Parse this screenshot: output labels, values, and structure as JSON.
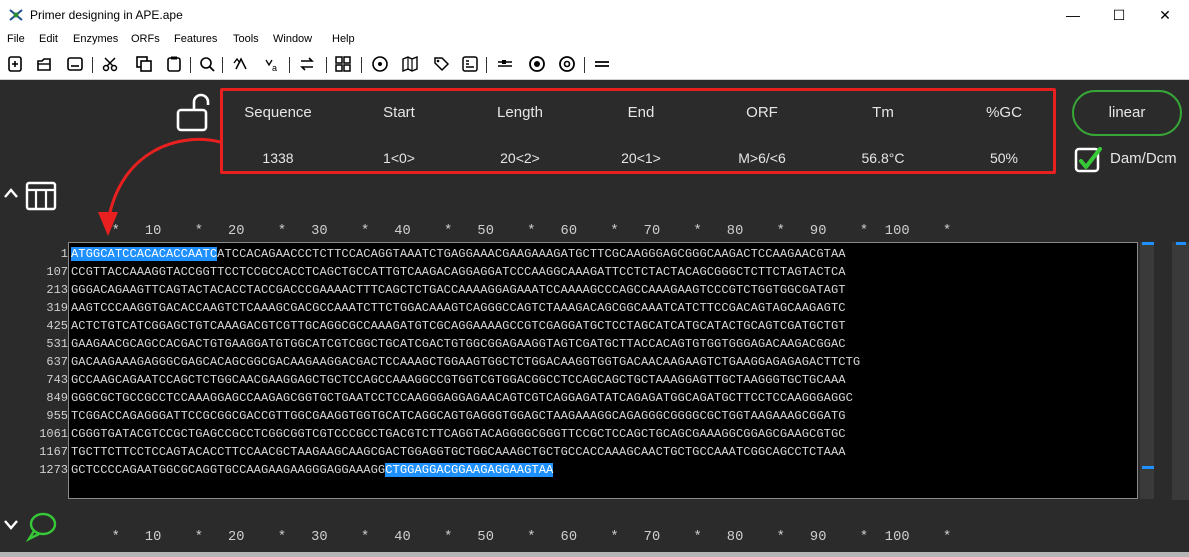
{
  "window": {
    "title": "Primer designing in APE.ape",
    "minimize": "—",
    "maximize": "☐",
    "close": "✕"
  },
  "menu": [
    "File",
    "Edit",
    "Enzymes",
    "ORFs",
    "Features",
    "Tools",
    "Window",
    "Help"
  ],
  "toolbar_icons": [
    "new-file-icon",
    "open-file-icon",
    "save-icon",
    "cut-icon",
    "copy-icon",
    "paste-icon",
    "find-icon",
    "translate-forward-icon",
    "translate-reverse-icon",
    "reverse-complement-icon",
    "enzyme-table-icon",
    "circular-map-icon",
    "linear-map-icon",
    "tag-icon",
    "features-icon",
    "align-icon",
    "gel-icon",
    "cd-icon",
    "list-icon"
  ],
  "info": {
    "headers": [
      "Sequence",
      "Start",
      "Length",
      "End",
      "ORF",
      "Tm",
      "%GC"
    ],
    "values": [
      "1338",
      "1<0>",
      "20<2>",
      "20<1>",
      "M>6/<6",
      "56.8°C",
      "50%"
    ]
  },
  "topology_button": "linear",
  "dam_dcm_label": "Dam/Dcm",
  "dam_dcm_checked": true,
  "ruler": "     *   10    *   20    *   30    *   40    *   50    *   60    *   70    *   80    *   90    *  100    *",
  "sequence": {
    "line_numbers": [
      "1",
      "107",
      "213",
      "319",
      "425",
      "531",
      "637",
      "743",
      "849",
      "955",
      "1061",
      "1167",
      "1273"
    ],
    "lines": [
      {
        "hl_start": "ATGGCATCCACACACCAATC",
        "text": "ATCCACAGAACCCTCTTCCACAGGTAAATCTGAGGAAACGAAGAAAGATGCTTCGCAAGGGAGCGGGCAAGACTCCAAGAACGTAA",
        "hl_end": ""
      },
      {
        "hl_start": "",
        "text": "CCGTTACCAAAGGTACCGGTTCCTCCGCCACCTCAGCTGCCATTGTCAAGACAGGAGGATCCCAAGGCAAAGATTCCTCTACTACAGCGGGCTCTTCTAGTACTCA",
        "hl_end": ""
      },
      {
        "hl_start": "",
        "text": "GGGACAGAAGTTCAGTACTACACCTACCGACCCGAAAACTTTCAGCTCTGACCAAAAGGAGAAATCCAAAAGCCCAGCCAAAGAAGTCCCGTCTGGTGGCGATAGT",
        "hl_end": ""
      },
      {
        "hl_start": "",
        "text": "AAGTCCCAAGGTGACACCAAGTCTCAAAGCGACGCCAAATCTTCTGGACAAAGTCAGGGCCAGTCTAAAGACAGCGGCAAATCATCTTCCGACAGTAGCAAGAGTC",
        "hl_end": ""
      },
      {
        "hl_start": "",
        "text": "ACTCTGTCATCGGAGCTGTCAAAGACGTCGTTGCAGGCGCCAAAGATGTCGCAGGAAAAGCCGTCGAGGATGCTCCTAGCATCATGCATACTGCAGTCGATGCTGT",
        "hl_end": ""
      },
      {
        "hl_start": "",
        "text": "GAAGAACGCAGCCACGACTGTGAAGGATGTGGCATCGTCGGCTGCATCGACTGTGGCGGAGAAGGTAGTCGATGCTTACCACAGTGTGGTGGGAGACAAGACGGAC",
        "hl_end": ""
      },
      {
        "hl_start": "",
        "text": "GACAAGAAAGAGGGCGAGCACAGCGGCGACAAGAAGGACGACTCCAAAGCTGGAAGTGGCTCTGGACAAGGTGGTGACAACAAGAAGTCTGAAGGAGAGAGACTTCTG",
        "hl_end": ""
      },
      {
        "hl_start": "",
        "text": "GCCAAGCAGAATCCAGCTCTGGCAACGAAGGAGCTGCTCCAGCCAAAGGCCGTGGTCGTGGACGGCCTCCAGCAGCTGCTAAAGGAGTTGCTAAGGGTGCTGCAAA",
        "hl_end": ""
      },
      {
        "hl_start": "",
        "text": "GGGCGCTGCCGCCTCCAAAGGAGCCAAGAGCGGTGCTGAATCCTCCAAGGGAGGAGAACAGTCGTCAGGAGATATCAGAGATGGCAGATGCTTCCTCCAAGGGAGGC",
        "hl_end": ""
      },
      {
        "hl_start": "",
        "text": "TCGGACCAGAGGGATTCCGCGGCGACCGTTGGCGAAGGTGGTGCATCAGGCAGTGAGGGTGGAGCTAAGAAAGGCAGAGGGCGGGGCGCTGGTAAGAAAGCGGATG",
        "hl_end": ""
      },
      {
        "hl_start": "",
        "text": "CGGGTGATACGTCCGCTGAGCCGCCTCGGCGGTCGTCCCGCCTGACGTCTTCAGGTACAGGGGCGGGTTCCGCTCCAGCTGCAGCGAAAGGCGGAGCGAAGCGTGC",
        "hl_end": ""
      },
      {
        "hl_start": "",
        "text": "TGCTTCTTCCTCCAGTACACCTTCCAACGCTAAGAAGCAAGCGACTGGAGGTGCTGGCAAAGCTGCTGCCACCAAAGCAACTGCTGCCAAATCGGCAGCCTCTAAA",
        "hl_end": ""
      },
      {
        "hl_start": "",
        "text": "GCTCCCCAGAATGGCGCAGGTGCCAAGAAGAAGGGAGGAAAGG",
        "hl_end": "CTGGAGGACGGAAGAGGAAGTAA"
      }
    ]
  },
  "colors": {
    "background": "#2b2b2b",
    "sequence_bg": "#000000",
    "highlight": "#1e90ff",
    "info_border": "#e8201f",
    "linear_border": "#37a837",
    "arrow": "#e8201f"
  }
}
